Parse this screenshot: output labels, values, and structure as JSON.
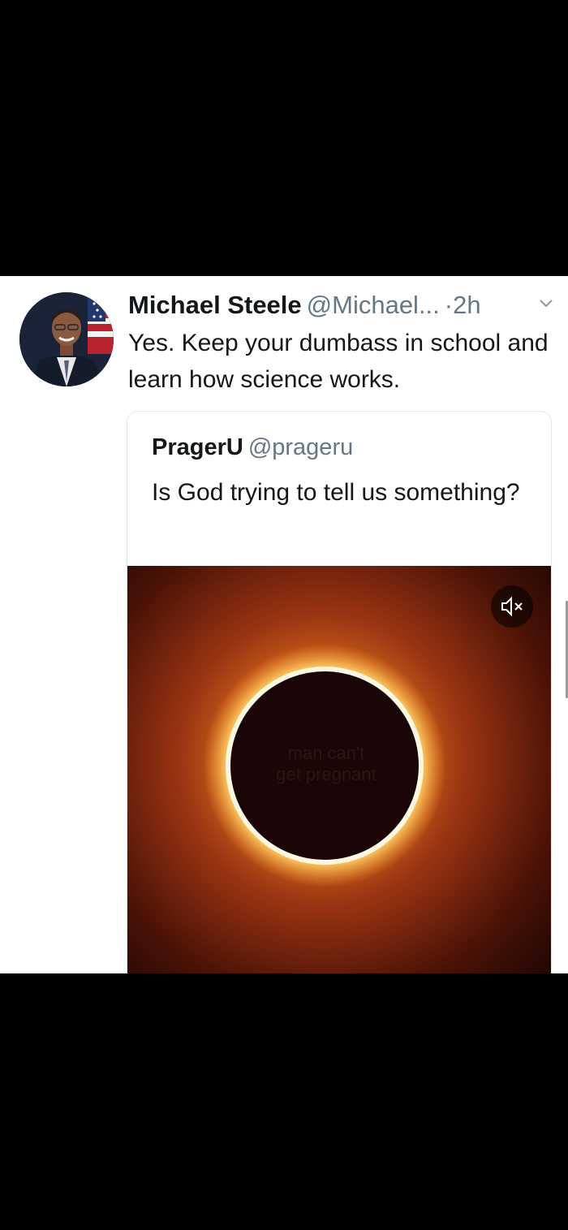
{
  "tweet": {
    "author_name": "Michael Steele",
    "author_handle": "@Michael...",
    "separator": "·",
    "time": "2h",
    "text": "Yes. Keep your dumbass in school and learn how science works."
  },
  "quoted_tweet": {
    "author_name": "PragerU",
    "author_handle": "@prageru",
    "text": "Is God trying to tell us something?",
    "media": {
      "overlay_line_1": "man can't",
      "overlay_line_2": "get pregnant",
      "muted": true
    }
  },
  "icons": {
    "chevron": "chevron-down-icon",
    "mute": "speaker-muted-icon"
  },
  "colors": {
    "text_primary": "#14171a",
    "text_secondary": "#657786",
    "card_border": "#e1e8ed",
    "eclipse_glow": "#ffd36b",
    "eclipse_bg": "#3a0d05"
  }
}
